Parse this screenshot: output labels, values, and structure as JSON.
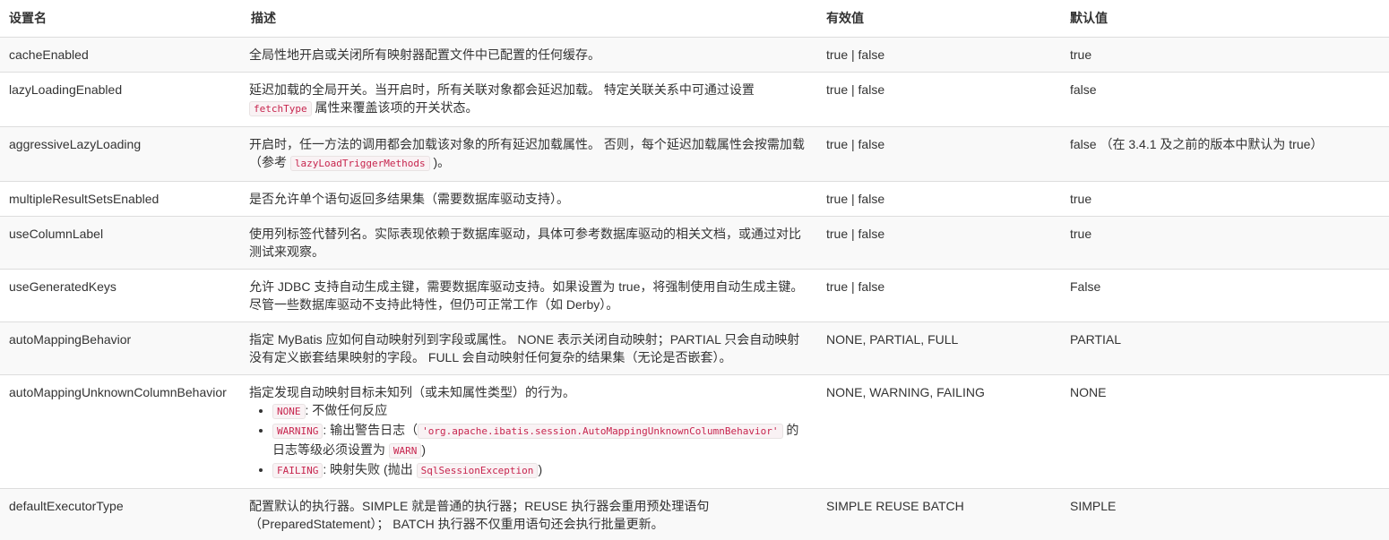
{
  "headers": {
    "name": "设置名",
    "description": "描述",
    "valid_values": "有效值",
    "default": "默认值"
  },
  "rows": [
    {
      "name": "cacheEnabled",
      "desc": "全局性地开启或关闭所有映射器配置文件中已配置的任何缓存。",
      "valid": "true | false",
      "default": "true"
    },
    {
      "name": "lazyLoadingEnabled",
      "desc_before": "延迟加载的全局开关。当开启时，所有关联对象都会延迟加载。 特定关联关系中可通过设置",
      "desc_code": "fetchType",
      "desc_after": "属性来覆盖该项的开关状态。",
      "valid": "true | false",
      "default": "false"
    },
    {
      "name": "aggressiveLazyLoading",
      "desc_before": "开启时，任一方法的调用都会加载该对象的所有延迟加载属性。 否则，每个延迟加载属性会按需加载（参考",
      "desc_code": "lazyLoadTriggerMethods",
      "desc_after": ")。",
      "valid": "true | false",
      "default": "false （在 3.4.1 及之前的版本中默认为 true）"
    },
    {
      "name": "multipleResultSetsEnabled",
      "desc": "是否允许单个语句返回多结果集（需要数据库驱动支持）。",
      "valid": "true | false",
      "default": "true"
    },
    {
      "name": "useColumnLabel",
      "desc": "使用列标签代替列名。实际表现依赖于数据库驱动，具体可参考数据库驱动的相关文档，或通过对比测试来观察。",
      "valid": "true | false",
      "default": "true"
    },
    {
      "name": "useGeneratedKeys",
      "desc": "允许 JDBC 支持自动生成主键，需要数据库驱动支持。如果设置为 true，将强制使用自动生成主键。尽管一些数据库驱动不支持此特性，但仍可正常工作（如 Derby）。",
      "valid": "true | false",
      "default": "False"
    },
    {
      "name": "autoMappingBehavior",
      "desc": "指定 MyBatis 应如何自动映射列到字段或属性。 NONE 表示关闭自动映射；PARTIAL 只会自动映射没有定义嵌套结果映射的字段。 FULL 会自动映射任何复杂的结果集（无论是否嵌套）。",
      "valid": "NONE, PARTIAL, FULL",
      "default": "PARTIAL"
    },
    {
      "name": "autoMappingUnknownColumnBehavior",
      "desc": "指定发现自动映射目标未知列（或未知属性类型）的行为。",
      "options": [
        {
          "code": "NONE",
          "text": ": 不做任何反应"
        },
        {
          "code": "WARNING",
          "text_before": ": 输出警告日志（",
          "code2": "'org.apache.ibatis.session.AutoMappingUnknownColumnBehavior'",
          "text_mid": " 的日志等级必须设置为 ",
          "code3": "WARN",
          "text_after": ")"
        },
        {
          "code": "FAILING",
          "text_before": ": 映射失败 (抛出 ",
          "code2": "SqlSessionException",
          "text_after": ")"
        }
      ],
      "valid": "NONE, WARNING, FAILING",
      "default": "NONE"
    },
    {
      "name": "defaultExecutorType",
      "desc": "配置默认的执行器。SIMPLE 就是普通的执行器；REUSE 执行器会重用预处理语句（PreparedStatement）； BATCH 执行器不仅重用语句还会执行批量更新。",
      "valid": "SIMPLE REUSE BATCH",
      "default": "SIMPLE"
    }
  ]
}
